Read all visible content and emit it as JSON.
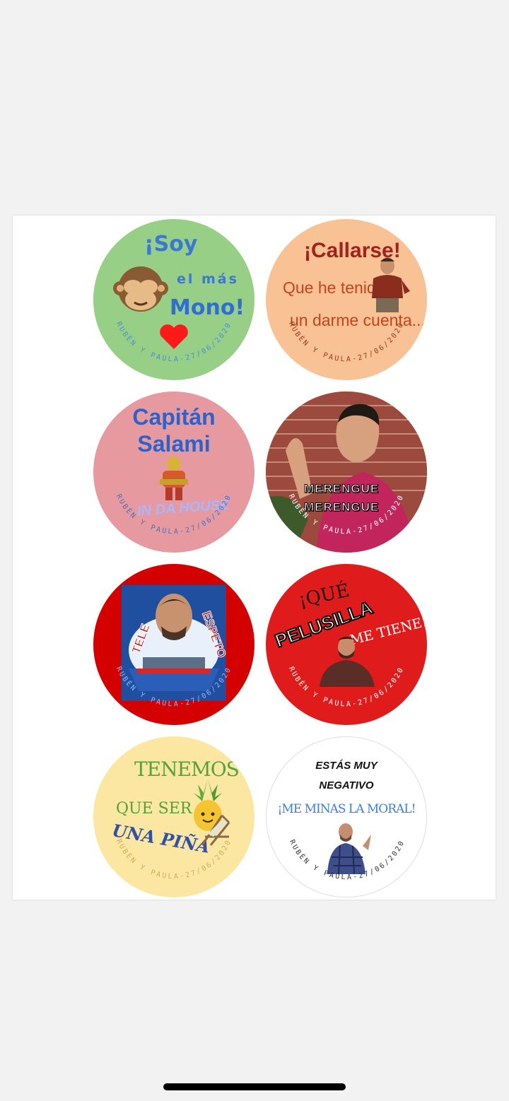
{
  "stickers": [
    {
      "id": "mono",
      "background": "#97cf87",
      "lines": [
        "¡Soy",
        "el más",
        "Mono!"
      ],
      "footer": "RUBÉN Y PAULA-27/06/2020",
      "footer_color": "#4e8fd0",
      "icons": [
        "see-no-evil-monkey-icon",
        "red-heart-icon"
      ]
    },
    {
      "id": "callarse",
      "background": "#f9c294",
      "lines": [
        "¡Callarse!",
        "Que he tenido",
        "un darme cuenta..."
      ],
      "footer": "RUBÉN Y PAULA-27/06/2020",
      "footer_color": "#9a3a1f",
      "icons": [
        "man-in-shirt-photo"
      ]
    },
    {
      "id": "salami",
      "background": "#e69aa0",
      "lines": [
        "Capitán",
        "Salami",
        "IN DA HOUSE"
      ],
      "footer": "RUBÉN Y PAULA-27/06/2020",
      "footer_color": "#4e6fb8",
      "icons": [
        "wrestler-figure-photo"
      ]
    },
    {
      "id": "merengue",
      "background": "#c94a5c",
      "lines": [
        "MERENGUE",
        "MERENGUE"
      ],
      "footer": "RUBÉN Y PAULA-27/06/2020",
      "footer_color": "#ffffff",
      "icons": [
        "brick-wall-background",
        "man-waving-photo"
      ]
    },
    {
      "id": "espeto",
      "background": "#d40000",
      "lines": [
        "TELE",
        "ESPETO"
      ],
      "footer": "RUBÉN Y PAULA-27/06/2020",
      "footer_color": "#8fb5ff",
      "icons": [
        "boat-poster-photo"
      ]
    },
    {
      "id": "pelusilla",
      "background": "#e01b1b",
      "lines": [
        "¡QUÉ",
        "PELUSILLA",
        "ME TIENE!"
      ],
      "footer": "RUBÉN Y PAULA-27/06/2020",
      "footer_color": "#ffffff",
      "icons": [
        "bearded-man-photo"
      ]
    },
    {
      "id": "pina",
      "background": "#fbe7a1",
      "lines": [
        "TENEMOS",
        "QUE SER",
        "UNA PIÑA"
      ],
      "footer": "RUBÉN Y PAULA-27/06/2020",
      "footer_color": "#c9b257",
      "icons": [
        "pineapple-icon",
        "beach-chair-icon"
      ]
    },
    {
      "id": "negativo",
      "background": "#ffffff",
      "lines": [
        "ESTÁS MUY",
        "NEGATIVO",
        "¡ME MINAS LA MORAL!"
      ],
      "footer": "RUBÉN Y PAULA-27/06/2020",
      "footer_color": "#333333",
      "icons": [
        "man-plaid-shirt-photo"
      ]
    }
  ]
}
